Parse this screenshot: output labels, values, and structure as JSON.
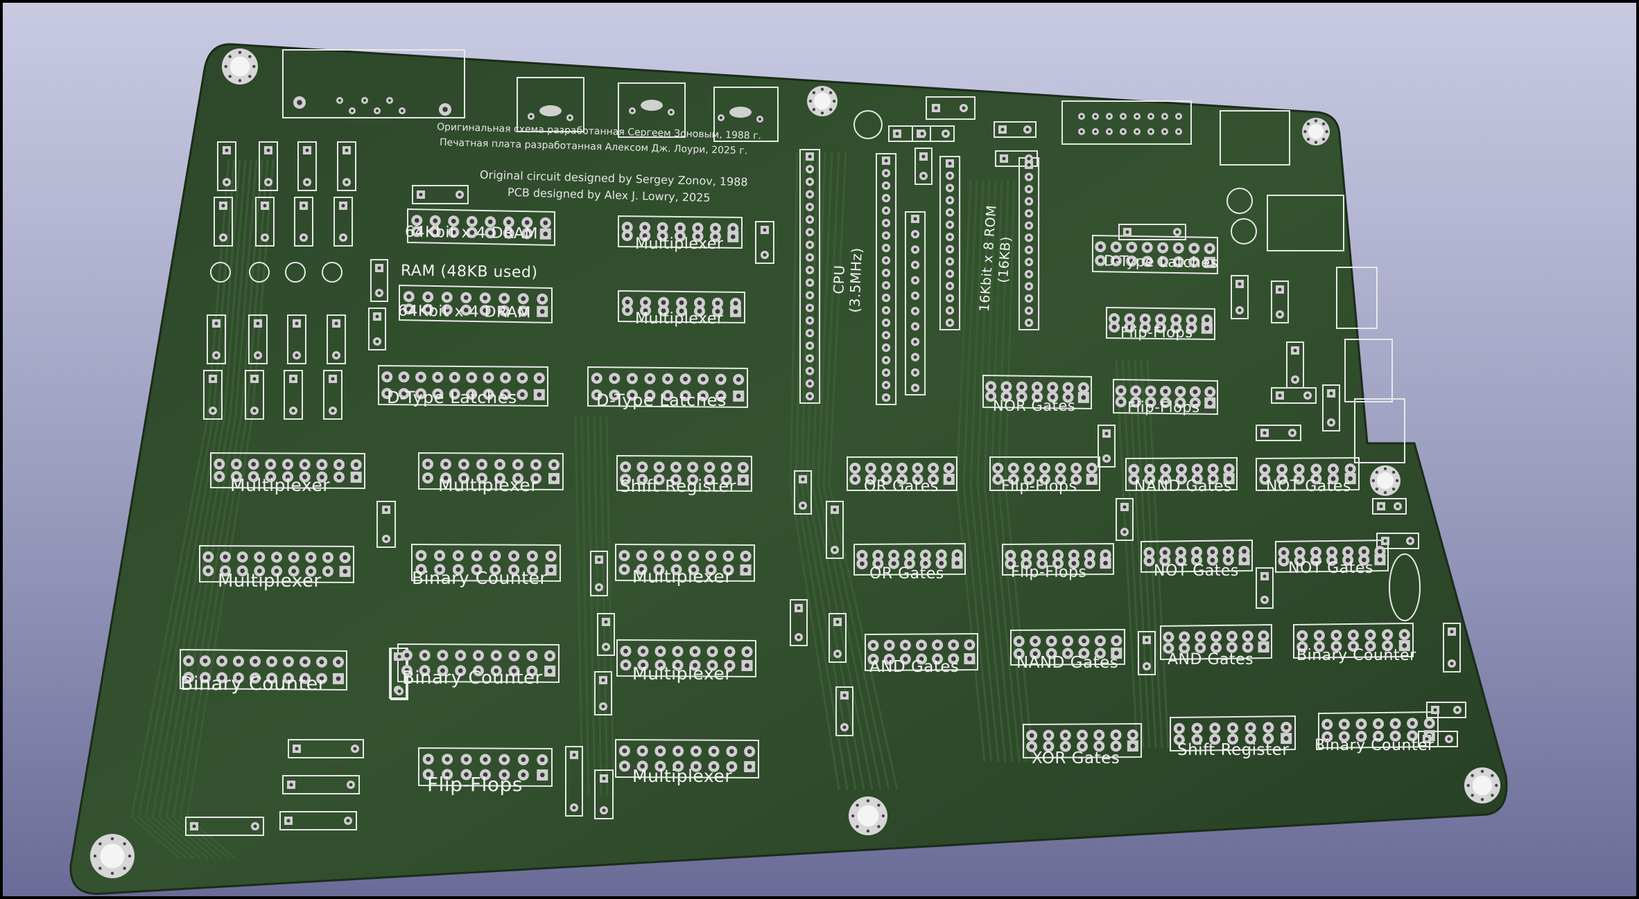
{
  "scene": {
    "subject": "pcb-3d-view",
    "board_color": "#2f4a2c",
    "silkscreen_color": "#f0f0f0",
    "pad_color": "#c9c9c9",
    "background_top": "#c9cbe3",
    "background_bottom": "#6a6c97"
  },
  "credits": {
    "ru_line1": "Оригинальная схема разработанная Сергеем Зоновым, 1988 г.",
    "ru_line2": "Печатная плата разработанная Алексом Дж. Лоури, 2025 г.",
    "en_line1": "Original circuit designed by Sergey Zonov, 1988",
    "en_line2": "PCB designed by Alex J. Lowry, 2025"
  },
  "labels": {
    "dram_top": "64Kbit x 4 DRAM",
    "ram_used": "RAM (48KB used)",
    "dram_bottom": "64Kbit x 4 DRAM",
    "mux_top1": "Multiplexer",
    "mux_top2": "Multiplexer",
    "cpu_line1": "CPU",
    "cpu_line2": "(3.5MHz)",
    "rom_line1": "16Kbit x 8 ROM",
    "rom_line2": "(16KB)",
    "dlatch_right": "D-Type Latches",
    "flipflops_r1": "Flip-Flops",
    "flipflops_r2": "Flip-Flops",
    "dlatch_left": "D-Type Latches",
    "dlatch_mid": "D-Type Latches",
    "nor_gates": "NOR Gates",
    "mux_l1": "Multiplexer",
    "mux_l2": "Multiplexer",
    "shift_reg_mid": "Shift Register",
    "or_gates1": "OR Gates",
    "flipflops_c1": "Flip-Flops",
    "nand_gates1": "NAND Gates",
    "not_gates1": "NOT Gates",
    "mux_l3": "Multiplexer",
    "bin_counter_l1": "Binary Counter",
    "mux_mid2": "Multiplexer",
    "or_gates2": "OR Gates",
    "flipflops_c2": "Flip-Flops",
    "not_gates2": "NOT Gates",
    "not_gates3": "NOT Gates",
    "bin_counter_l2": "Binary Counter",
    "bin_counter_l3": "Binary Counter",
    "mux_mid3": "Multiplexer",
    "and_gates1": "AND Gates",
    "nand_gates2": "NAND Gates",
    "and_gates2": "AND Gates",
    "bin_counter_r1": "Binary Counter",
    "flipflops_bl": "Flip-Flops",
    "mux_mid4": "Multiplexer",
    "xor_gates": "XOR Gates",
    "shift_reg_r": "Shift Register",
    "bin_counter_r2": "Binary Counter"
  }
}
